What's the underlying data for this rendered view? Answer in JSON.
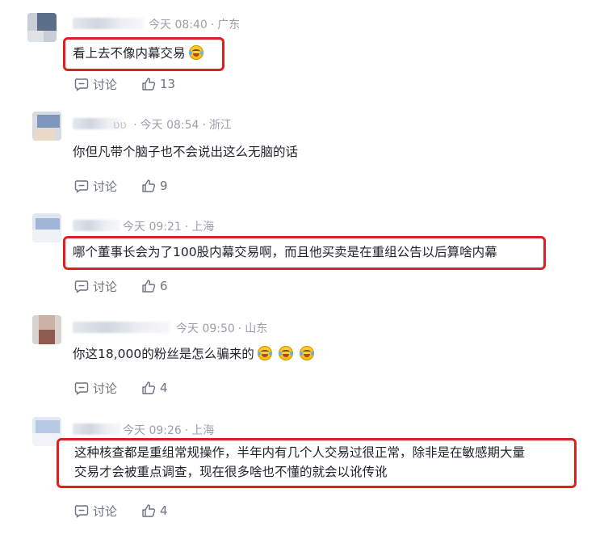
{
  "comments": [
    {
      "meta_time": "今天 08:40",
      "meta_loc": "广东",
      "text": "看上去不像内幕交易",
      "emoji_count": 1,
      "highlighted": true,
      "comment_label": "讨论",
      "likes": "13"
    },
    {
      "meta_name_fragment": "ʋʋ",
      "meta_time": "今天 08:54",
      "meta_loc": "浙江",
      "text": "你但凡带个脑子也不会说出这么无脑的话",
      "highlighted": false,
      "comment_label": "讨论",
      "likes": "9"
    },
    {
      "meta_time": "今天 09:21",
      "meta_loc": "上海",
      "text": "哪个董事长会为了100股内幕交易啊，而且他买卖是在重组公告以后算啥内幕",
      "highlighted": true,
      "comment_label": "讨论",
      "likes": "6"
    },
    {
      "meta_time": "今天 09:50",
      "meta_loc": "山东",
      "text": "你这18,000的粉丝是怎么骗来的",
      "emoji_count": 3,
      "highlighted": false,
      "comment_label": "讨论",
      "likes": "4"
    },
    {
      "meta_time": "今天 09:26",
      "meta_loc": "上海",
      "text_line1": "这种核查都是重组常规操作，半年内有几个人交易过很正常，除非是在敏感期大量",
      "text_line2": "交易才会被重点调查，现在很多啥也不懂的就会以讹传讹",
      "highlighted": true,
      "comment_label": "讨论",
      "likes": "4"
    }
  ],
  "icons": {
    "comment": "comment-bubble-icon",
    "like": "thumb-up-icon",
    "emoji": "laughing-crying-emoji-icon"
  },
  "colors": {
    "highlight": "#e02020",
    "meta": "#9aa0a8",
    "text": "#1f2329",
    "action": "#6b7280"
  }
}
